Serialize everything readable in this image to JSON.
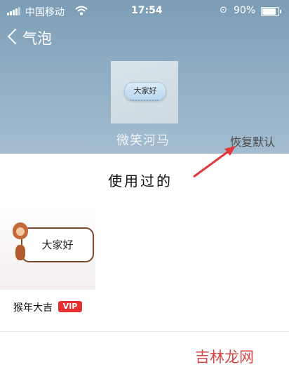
{
  "status_bar": {
    "carrier": "中国移动",
    "time": "17:54",
    "battery": "90%",
    "battery_level": 0.9
  },
  "nav": {
    "back_label": "气泡"
  },
  "current": {
    "bubble_text": "大家好",
    "name": "微笑河马",
    "restore_label": "恢复默认"
  },
  "section": {
    "title": "使用过的"
  },
  "used_items": [
    {
      "bubble_text": "大家好",
      "name": "猴年大吉",
      "badge": "VIP"
    }
  ],
  "watermark": "吉林龙网",
  "colors": {
    "header_top": "#7c9db6",
    "header_bottom": "#a3bcd0",
    "vip_badge": "#e43030",
    "annotation_arrow": "#e23a3a",
    "watermark": "#d54545"
  }
}
